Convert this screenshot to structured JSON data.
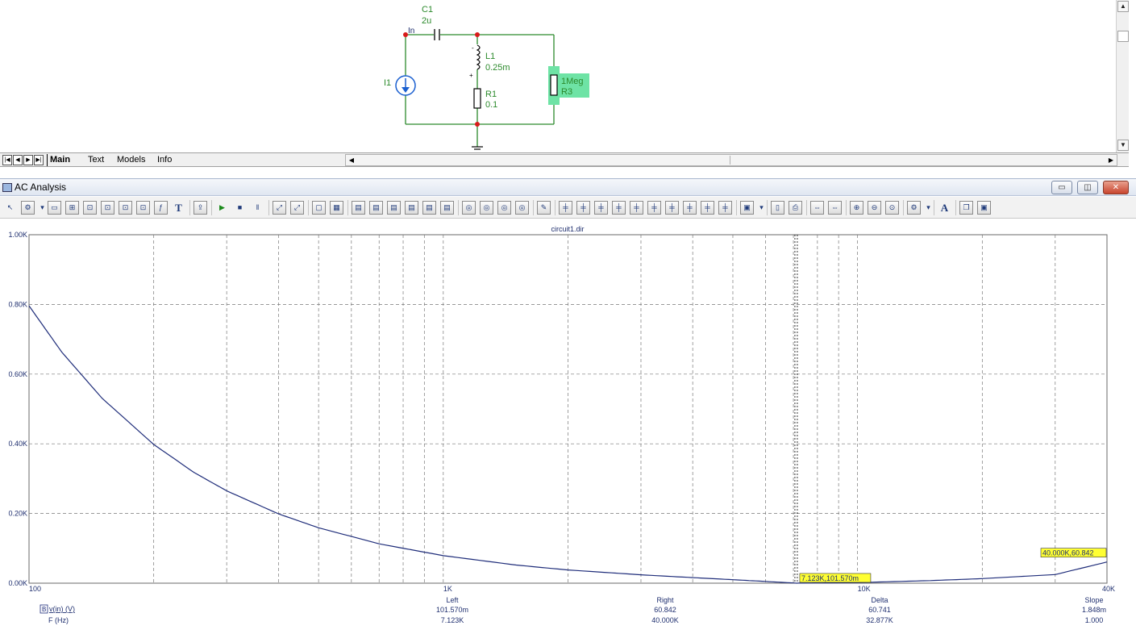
{
  "schematic": {
    "components": {
      "c1": {
        "name": "C1",
        "value": "2u"
      },
      "l1": {
        "name": "L1",
        "value": "0.25m"
      },
      "r1": {
        "name": "R1",
        "value": "0.1"
      },
      "r3": {
        "name": "R3",
        "value": "1Meg"
      },
      "i1": {
        "name": "I1"
      },
      "node_in": "In"
    },
    "colors": {
      "wire": "#2c8a2c",
      "node": "#d81b1b",
      "source": "#1a5fd0",
      "selection": "#6ee3a5"
    }
  },
  "tabs": [
    {
      "label": "Main",
      "active": true
    },
    {
      "label": "Text",
      "active": false
    },
    {
      "label": "Models",
      "active": false
    },
    {
      "label": "Info",
      "active": false
    }
  ],
  "window": {
    "title": "AC Analysis",
    "min_icon": "minimize-icon",
    "max_icon": "maximize-icon",
    "close_icon": "close-icon"
  },
  "toolbar": {
    "icons": [
      "pointer-icon",
      "options-icon",
      "dropdown-icon",
      "window-icon",
      "zoom-fit-icon",
      "axis-icon",
      "axis-icon",
      "axis-icon",
      "axis-icon",
      "function-icon",
      "text-icon",
      "export-icon",
      "run-icon",
      "stop-icon",
      "pause-icon",
      "cursor-icon",
      "cursor-icon",
      "frame-icon",
      "grid-icon",
      "layout-icon",
      "layout-icon",
      "layout-icon",
      "layout-icon",
      "layout-icon",
      "layout-icon",
      "zoom-icon",
      "zoom-icon",
      "zoom-icon",
      "zoom-icon",
      "properties-icon",
      "marker-icon",
      "marker-icon",
      "marker-icon",
      "marker-icon",
      "marker-icon",
      "marker-icon",
      "marker-icon",
      "marker-icon",
      "marker-icon",
      "marker-icon",
      "paste-icon",
      "dropdown-icon",
      "page-icon",
      "print-icon",
      "fit-icon",
      "fit-icon",
      "zoom-in-icon",
      "zoom-out-icon",
      "zoom-area-icon",
      "options-icon",
      "dropdown-icon",
      "font-icon",
      "copy-icon",
      "paste-icon"
    ],
    "font_label": "A",
    "text_label": "T"
  },
  "chart_data": {
    "type": "line",
    "title": "circuit1.dir",
    "x_scale": "log",
    "xlim": [
      100,
      40000
    ],
    "ylim": [
      0,
      1000
    ],
    "y_ticks": [
      0,
      200,
      400,
      600,
      800,
      1000
    ],
    "y_tick_labels": [
      "0.00K",
      "0.20K",
      "0.40K",
      "0.60K",
      "0.80K",
      "1.00K"
    ],
    "x_tick_labels": [
      "100",
      "1K",
      "10K",
      "40K"
    ],
    "grid": true,
    "series": [
      {
        "name": "v(in) (V)",
        "color": "#1f2d7a",
        "x": [
          100,
          120,
          150,
          200,
          250,
          300,
          400,
          500,
          700,
          1000,
          1500,
          2000,
          3000,
          4000,
          5000,
          6000,
          7123,
          8000,
          10000,
          15000,
          20000,
          30000,
          40000
        ],
        "values": [
          796,
          663,
          531,
          398,
          318,
          265,
          199,
          159,
          113,
          79,
          52,
          38,
          24,
          16,
          10,
          5,
          0.1,
          0.7,
          1.7,
          7.5,
          13.1,
          24.7,
          60.842
        ]
      }
    ],
    "legend": {
      "series_label": "v(in) (V)",
      "x_label": "F (Hz)"
    },
    "cursors": [
      {
        "x": 7123,
        "label": "7.123K,101.570m"
      },
      {
        "x": 40000,
        "label": "40.000K,60.842"
      }
    ],
    "measurements": [
      {
        "header": "Left",
        "y": "101.570m",
        "x": "7.123K"
      },
      {
        "header": "Right",
        "y": "60.842",
        "x": "40.000K"
      },
      {
        "header": "Delta",
        "y": "60.741",
        "x": "32.877K"
      },
      {
        "header": "Slope",
        "y": "1.848m",
        "x": "1.000"
      }
    ]
  }
}
